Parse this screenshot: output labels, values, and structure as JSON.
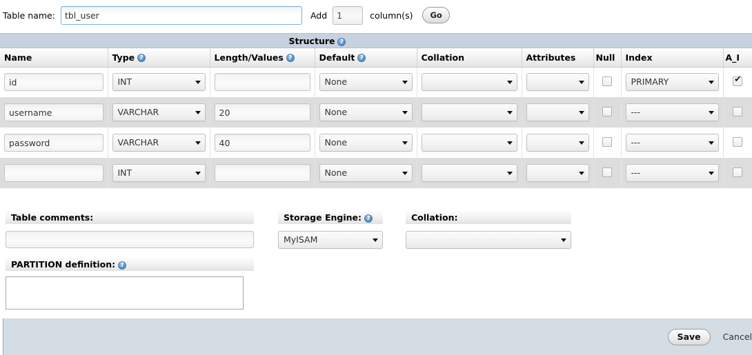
{
  "toolbar": {
    "table_name_label": "Table name:",
    "table_name_value": "tbl_user",
    "add_label": "Add",
    "add_count_value": "1",
    "columns_label": "column(s)",
    "go_label": "Go"
  },
  "structure": {
    "band_title": "Structure",
    "help_glyph": "?",
    "columns": [
      {
        "label": "Name",
        "help": false
      },
      {
        "label": "Type",
        "help": true
      },
      {
        "label": "Length/Values",
        "help": true
      },
      {
        "label": "Default",
        "help": true
      },
      {
        "label": "Collation",
        "help": false
      },
      {
        "label": "Attributes",
        "help": false
      },
      {
        "label": "Null",
        "help": false
      },
      {
        "label": "Index",
        "help": false
      },
      {
        "label": "A_I",
        "help": false
      }
    ],
    "rows": [
      {
        "name": "id",
        "type": "INT",
        "length": "",
        "default": "None",
        "collation": "",
        "attributes": "",
        "null_checked": false,
        "index": "PRIMARY",
        "ai_checked": true
      },
      {
        "name": "username",
        "type": "VARCHAR",
        "length": "20",
        "default": "None",
        "collation": "",
        "attributes": "",
        "null_checked": false,
        "index": "---",
        "ai_checked": false
      },
      {
        "name": "password",
        "type": "VARCHAR",
        "length": "40",
        "default": "None",
        "collation": "",
        "attributes": "",
        "null_checked": false,
        "index": "---",
        "ai_checked": false
      },
      {
        "name": "",
        "type": "INT",
        "length": "",
        "default": "None",
        "collation": "",
        "attributes": "",
        "null_checked": false,
        "index": "---",
        "ai_checked": false
      }
    ]
  },
  "options": {
    "table_comments_label": "Table comments:",
    "table_comments_value": "",
    "partition_label": "PARTITION definition:",
    "partition_value": "",
    "storage_engine_label": "Storage Engine:",
    "storage_engine_value": "MyISAM",
    "collation_label": "Collation:",
    "collation_value": ""
  },
  "footer": {
    "save_label": "Save",
    "cancel_label": "Cancel"
  },
  "colors": {
    "band": "#c8d2de",
    "footer": "#d4dce4",
    "row_alt": "#dddddd",
    "focus_border": "#7aafdd"
  }
}
